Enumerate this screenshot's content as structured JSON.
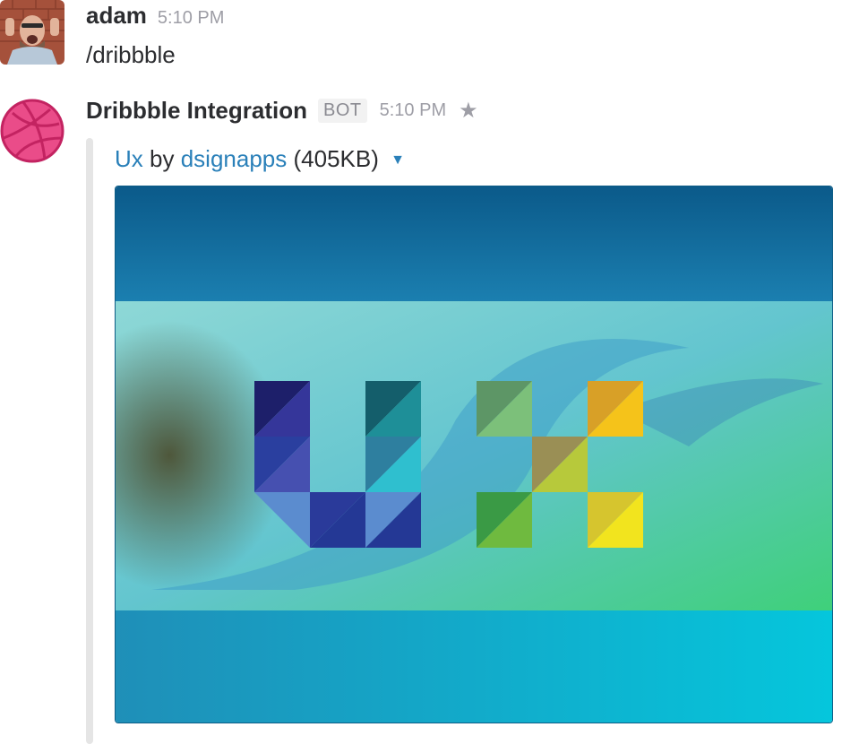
{
  "messages": [
    {
      "username": "adam",
      "time": "5:10 PM",
      "text": "/dribbble"
    },
    {
      "username": "Dribbble Integration",
      "bot_badge": "BOT",
      "time": "5:10 PM",
      "attachment": {
        "title": "Ux",
        "by": "by",
        "author": "dsignapps",
        "size": "(405KB)"
      }
    }
  ],
  "colors": {
    "link": "#2a80b9",
    "timestamp": "#9e9ea6",
    "dribbble_pink": "#ea4c89"
  }
}
